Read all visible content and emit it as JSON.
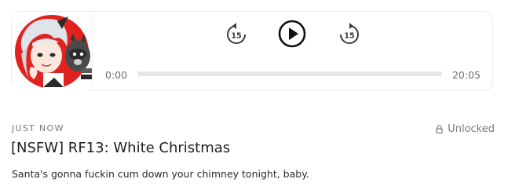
{
  "player": {
    "time_start": "0:00",
    "time_end": "20:05",
    "skip_back_label": "15",
    "skip_forward_label": "15",
    "progress": 0
  },
  "post": {
    "timestamp": "JUST NOW",
    "access": "Unlocked",
    "title": "[NSFW] RF13: White Christmas",
    "description": "Santa's gonna fuckin cum down your chimney tonight, baby."
  },
  "colors": {
    "cover_red": "#e0231f",
    "text": "#1f1f1f",
    "muted": "#777777"
  },
  "icons": [
    "skip-back-15-icon",
    "play-icon",
    "skip-forward-15-icon",
    "lock-icon"
  ]
}
